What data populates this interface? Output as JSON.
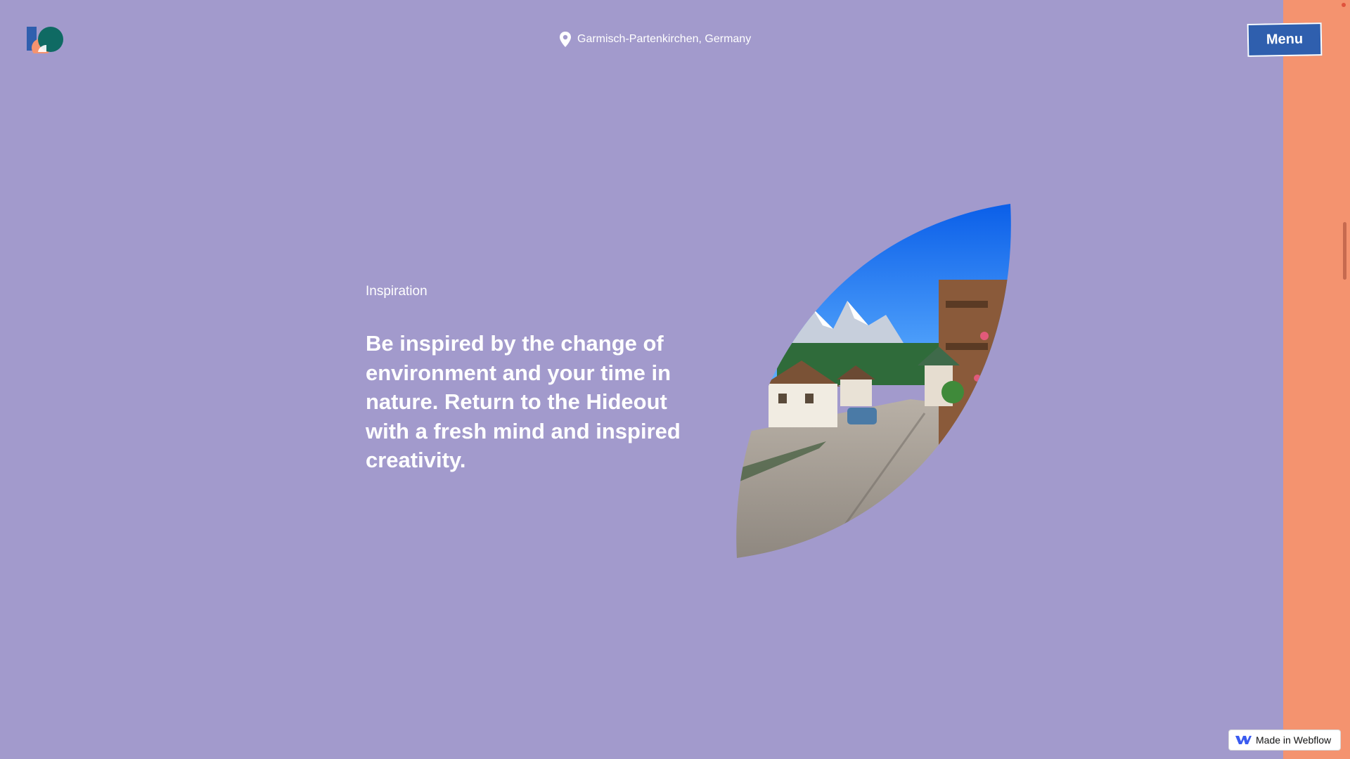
{
  "header": {
    "logo_icon": "brand-logo-icon",
    "location_icon": "map-pin-icon",
    "location": "Garmisch-Partenkirchen, Germany",
    "menu_label": "Menu"
  },
  "main": {
    "eyebrow": "Inspiration",
    "headline": "Be inspired by the change of environment and your time in nature. Return to the Hideout with a fresh mind and inspired creativity.",
    "image_subject": "alpine-village-street-photo"
  },
  "badge": {
    "icon": "webflow-icon",
    "label": "Made in Webflow"
  },
  "colors": {
    "background": "#a29acc",
    "side_strip": "#f4936f",
    "menu_button": "#2f5fae",
    "text": "#ffffff"
  }
}
